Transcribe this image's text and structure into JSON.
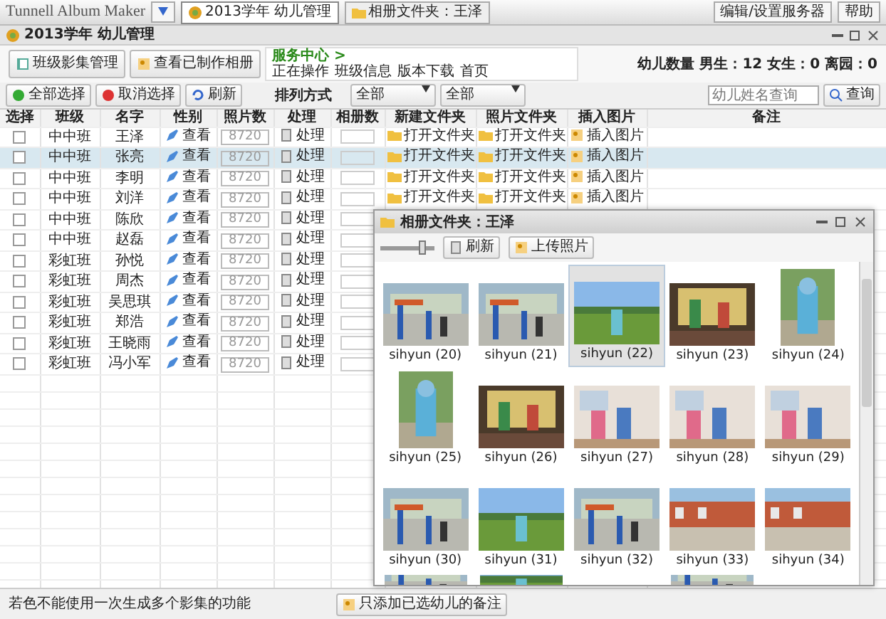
{
  "app": {
    "title": "Tunnell Album Maker",
    "tabs": [
      {
        "label": "2013学年 幼儿管理",
        "selected": true
      },
      {
        "label": "相册文件夹：王泽",
        "selected": false
      }
    ],
    "right_buttons": [
      "编辑/设置服务器",
      "帮助"
    ]
  },
  "window": {
    "title": "2013学年 幼儿管理"
  },
  "toolbar": {
    "buttons": [
      "班级影集管理",
      "查看已制作相册"
    ],
    "info_title": "服务中心 >",
    "info_links": [
      "正在操作",
      "班级信息",
      "版本下载",
      "首页"
    ],
    "stats": "幼儿数量 男生：12 女生：0 离园：0"
  },
  "filter": {
    "buttons": [
      "全部选择",
      "取消选择",
      "刷新"
    ],
    "sort_label": "排列方式",
    "selects": [
      "全部",
      "全部"
    ],
    "search": {
      "placeholder": "幼儿姓名查询"
    },
    "search_button": "查询"
  },
  "table": {
    "columns": [
      "选择",
      "班级",
      "名字",
      "性别",
      "照片数",
      "处理",
      "相册数",
      "新建文件夹",
      "照片文件夹",
      "插入图片",
      "备注"
    ],
    "rows": [
      {
        "checked": false,
        "selected": false,
        "class": "中中班",
        "name": "王泽",
        "action": "查看",
        "count": "8720",
        "edit": "处理",
        "folder1": "打开文件夹",
        "folder2": "打开文件夹",
        "insert": "插入图片"
      },
      {
        "checked": false,
        "selected": true,
        "class": "中中班",
        "name": "张亮",
        "action": "查看",
        "count": "8720",
        "edit": "处理",
        "folder1": "打开文件夹",
        "folder2": "打开文件夹",
        "insert": "插入图片"
      },
      {
        "checked": false,
        "selected": false,
        "class": "中中班",
        "name": "李明",
        "action": "查看",
        "count": "8720",
        "edit": "处理",
        "folder1": "打开文件夹",
        "folder2": "打开文件夹",
        "insert": "插入图片"
      },
      {
        "checked": false,
        "selected": false,
        "class": "中中班",
        "name": "刘洋",
        "action": "查看",
        "count": "8720",
        "edit": "处理",
        "folder1": "打开文件夹",
        "folder2": "打开文件夹",
        "insert": "插入图片"
      },
      {
        "checked": false,
        "selected": false,
        "class": "中中班",
        "name": "陈欣",
        "action": "查看",
        "count": "8720",
        "edit": "处理"
      },
      {
        "checked": false,
        "selected": false,
        "class": "中中班",
        "name": "赵磊",
        "action": "查看",
        "count": "8720",
        "edit": "处理"
      },
      {
        "checked": false,
        "selected": false,
        "class": "彩虹班",
        "name": "孙悦",
        "action": "查看",
        "count": "8720",
        "edit": "处理"
      },
      {
        "checked": false,
        "selected": false,
        "class": "彩虹班",
        "name": "周杰",
        "action": "查看",
        "count": "8720",
        "edit": "处理"
      },
      {
        "checked": false,
        "selected": false,
        "class": "彩虹班",
        "name": "吴思琪",
        "action": "查看",
        "count": "8720",
        "edit": "处理"
      },
      {
        "checked": false,
        "selected": false,
        "class": "彩虹班",
        "name": "郑浩",
        "action": "查看",
        "count": "8720",
        "edit": "处理"
      },
      {
        "checked": false,
        "selected": false,
        "class": "彩虹班",
        "name": "王晓雨",
        "action": "查看",
        "count": "8720",
        "edit": "处理"
      },
      {
        "checked": false,
        "selected": false,
        "class": "彩虹班",
        "name": "冯小军",
        "action": "查看",
        "count": "8720",
        "edit": "处理"
      }
    ]
  },
  "photo_window": {
    "title": "相册文件夹：王泽",
    "zoom": {
      "level": 0.8
    },
    "buttons": [
      "刷新",
      "上传照片"
    ],
    "photos": [
      {
        "label": "sihyun (20)",
        "kind": "park",
        "selected": false
      },
      {
        "label": "sihyun (21)",
        "kind": "park",
        "selected": false
      },
      {
        "label": "sihyun (22)",
        "kind": "field",
        "selected": true
      },
      {
        "label": "sihyun (23)",
        "kind": "stage",
        "selected": false
      },
      {
        "label": "sihyun (24)",
        "kind": "portrait",
        "selected": false
      },
      {
        "label": "sihyun (25)",
        "kind": "portrait",
        "selected": false
      },
      {
        "label": "sihyun (26)",
        "kind": "stage",
        "selected": false
      },
      {
        "label": "sihyun (27)",
        "kind": "indoor",
        "selected": false
      },
      {
        "label": "sihyun (28)",
        "kind": "indoor",
        "selected": false
      },
      {
        "label": "sihyun (29)",
        "kind": "indoor",
        "selected": false
      },
      {
        "label": "sihyun (30)",
        "kind": "park",
        "selected": false
      },
      {
        "label": "sihyun (31)",
        "kind": "field",
        "selected": false
      },
      {
        "label": "sihyun (32)",
        "kind": "park",
        "selected": false
      },
      {
        "label": "sihyun (33)",
        "kind": "school",
        "selected": false
      },
      {
        "label": "sihyun (34)",
        "kind": "school",
        "selected": false
      },
      {
        "kind": "park"
      },
      {
        "kind": "field"
      },
      {
        "kind": "empty"
      },
      {
        "kind": "park"
      },
      {
        "kind": "empty"
      }
    ]
  },
  "status_bar": {
    "text": "若色不能使用一次生成多个影集的功能",
    "button": "只添加已选幼儿的备注"
  }
}
